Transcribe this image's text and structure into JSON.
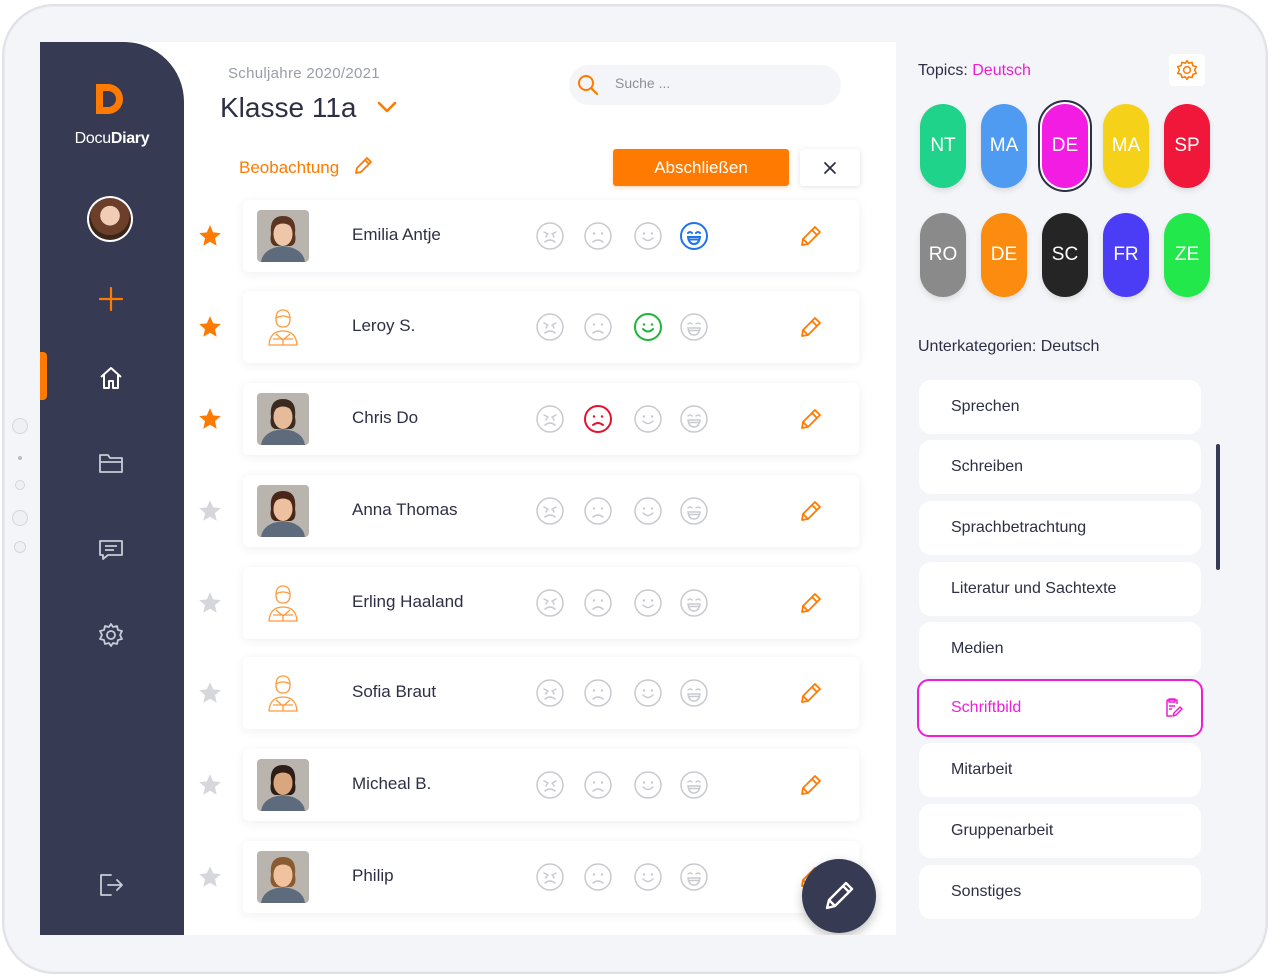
{
  "app": {
    "logo_letter": "D",
    "brand_light": "Docu",
    "brand_bold": "Diary",
    "brand_color": "#ff7a00",
    "sidebar_color": "#363a52"
  },
  "sidebar": {
    "items": [
      {
        "name": "add",
        "icon": "plus-icon"
      },
      {
        "name": "home",
        "icon": "home-icon",
        "active": true
      },
      {
        "name": "folder",
        "icon": "folder-icon"
      },
      {
        "name": "messages",
        "icon": "chat-icon"
      },
      {
        "name": "settings",
        "icon": "gear-icon"
      },
      {
        "name": "logout",
        "icon": "logout-icon"
      }
    ]
  },
  "header": {
    "school_year": "Schuljahre 2020/2021",
    "class_title": "Klasse 11a",
    "search_placeholder": "Suche ..."
  },
  "toolbar": {
    "observation_label": "Beobachtung",
    "finish_label": "Abschließen"
  },
  "students": [
    {
      "name": "Emilia Antje",
      "starred": true,
      "photo": "photo",
      "mood": 3,
      "skin": "#efc7a8",
      "hair": "#5a3622"
    },
    {
      "name": "Leroy S.",
      "starred": true,
      "photo": "placeholder",
      "mood": 2
    },
    {
      "name": "Chris Do",
      "starred": true,
      "photo": "photo",
      "mood": 1,
      "skin": "#e6bb9a",
      "hair": "#3a2a20"
    },
    {
      "name": "Anna Thomas",
      "starred": false,
      "photo": "photo",
      "mood": null,
      "skin": "#edc1a0",
      "hair": "#4a2618"
    },
    {
      "name": "Erling Haaland",
      "starred": false,
      "photo": "placeholder",
      "mood": null
    },
    {
      "name": "Sofia Braut",
      "starred": false,
      "photo": "placeholder",
      "mood": null
    },
    {
      "name": "Micheal B.",
      "starred": false,
      "photo": "photo",
      "mood": null,
      "skin": "#d9a67e",
      "hair": "#2c1e16"
    },
    {
      "name": "Philip",
      "starred": false,
      "photo": "photo",
      "mood": null,
      "skin": "#f0c29e",
      "hair": "#8a5a30"
    }
  ],
  "mood_colors": [
    "#e8112d",
    "#1fb53c",
    "#1f74e8"
  ],
  "topics_panel": {
    "label": "Topics:",
    "selected_topic": "Deutsch",
    "topics": [
      {
        "code": "NT",
        "color": "#1fd38a"
      },
      {
        "code": "MA",
        "color": "#4f9bf2"
      },
      {
        "code": "DE",
        "color": "#f21ce3",
        "selected": true
      },
      {
        "code": "MA",
        "color": "#f5d219"
      },
      {
        "code": "SP",
        "color": "#f0173a"
      },
      {
        "code": "RO",
        "color": "#8a8a8a"
      },
      {
        "code": "DE",
        "color": "#fb8c10"
      },
      {
        "code": "SC",
        "color": "#252525"
      },
      {
        "code": "FR",
        "color": "#4b3cf5"
      },
      {
        "code": "ZE",
        "color": "#23e84b"
      }
    ],
    "subcategories_label": "Unterkategorien: Deutsch",
    "subcategories": [
      {
        "label": "Sprechen"
      },
      {
        "label": "Schreiben"
      },
      {
        "label": "Sprachbetrachtung"
      },
      {
        "label": "Literatur und Sachtexte"
      },
      {
        "label": "Medien"
      },
      {
        "label": "Schriftbild",
        "active": true
      },
      {
        "label": "Mitarbeit"
      },
      {
        "label": "Gruppenarbeit"
      },
      {
        "label": "Sonstiges"
      }
    ]
  }
}
